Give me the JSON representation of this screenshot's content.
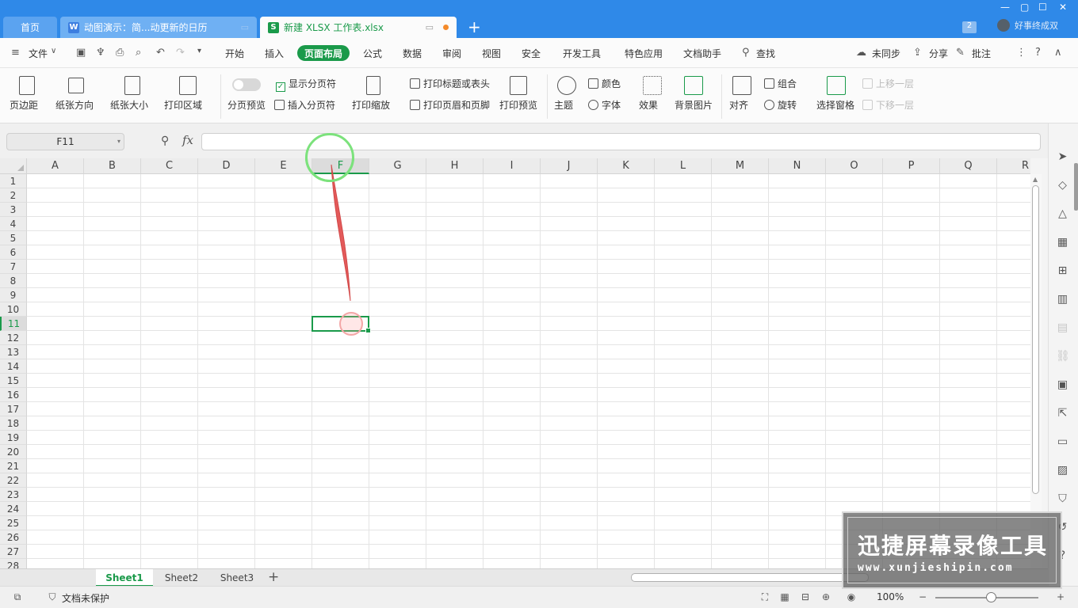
{
  "window": {
    "tabs": [
      {
        "label": "首页"
      },
      {
        "label": "动图演示：简...动更新的日历",
        "icon": "W"
      },
      {
        "label": "新建 XLSX 工作表.xlsx",
        "icon": "S"
      }
    ],
    "badge": "2",
    "user": "好事终成双",
    "new_tab": "+"
  },
  "menu": {
    "file": "文件",
    "items": [
      "开始",
      "插入",
      "页面布局",
      "公式",
      "数据",
      "审阅",
      "视图",
      "安全",
      "开发工具",
      "特色应用",
      "文档助手"
    ],
    "active": "页面布局",
    "search": "查找",
    "sync": "未同步",
    "share": "分享",
    "comment": "批注"
  },
  "ribbon": {
    "margins": "页边距",
    "orientation": "纸张方向",
    "size": "纸张大小",
    "print_area": "打印区域",
    "page_break_preview": "分页预览",
    "show_page_break": "显示分页符",
    "insert_page_break": "插入分页符",
    "print_scale": "打印缩放",
    "print_titles": "打印标题或表头",
    "header_footer": "打印页眉和页脚",
    "print_preview": "打印预览",
    "theme": "主题",
    "colors": "颜色",
    "fonts": "字体",
    "effects": "效果",
    "background": "背景图片",
    "align": "对齐",
    "group": "组合",
    "rotate": "旋转",
    "selection_pane": "选择窗格",
    "bring_forward": "上移一层",
    "send_backward": "下移一层"
  },
  "formula": {
    "name_box": "F11",
    "fx": "fx",
    "value": ""
  },
  "grid": {
    "columns": [
      "A",
      "B",
      "C",
      "D",
      "E",
      "F",
      "G",
      "H",
      "I",
      "J",
      "K",
      "L",
      "M",
      "N",
      "O",
      "P",
      "Q",
      "R"
    ],
    "rows": [
      "1",
      "2",
      "3",
      "4",
      "5",
      "6",
      "7",
      "8",
      "9",
      "10",
      "11",
      "12",
      "13",
      "14",
      "15",
      "16",
      "17",
      "18",
      "19",
      "20",
      "21",
      "22",
      "23",
      "24",
      "25",
      "26",
      "27",
      "28"
    ],
    "selected_column": "F",
    "selected_row": "11"
  },
  "sheets": {
    "tabs": [
      "Sheet1",
      "Sheet2",
      "Sheet3"
    ],
    "active": "Sheet1",
    "add": "+"
  },
  "status": {
    "protection": "文档未保护",
    "zoom": "100%"
  },
  "watermark": {
    "title": "迅捷屏幕录像工具",
    "url": "www.xunjieshipin.com"
  },
  "colors": {
    "accent": "#1a9a4a",
    "titlebar": "#2f89e8"
  }
}
